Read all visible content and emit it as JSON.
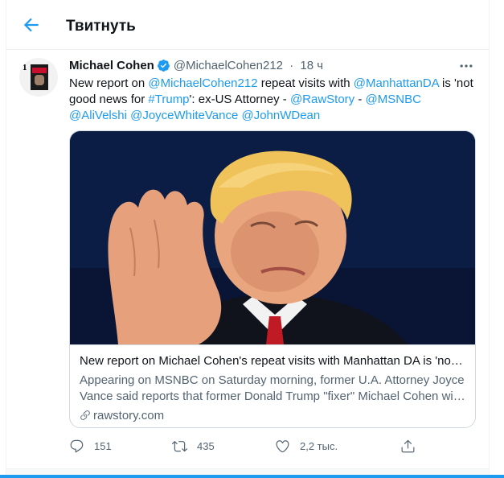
{
  "header": {
    "title": "Твитнуть"
  },
  "tweet": {
    "author_name": "Michael Cohen",
    "handle": "@MichaelCohen212",
    "separator": "·",
    "time": "18 ч",
    "avatar_number": "1",
    "text": {
      "p1": "New report on ",
      "m1": "@MichaelCohen212",
      "p2": " repeat visits with ",
      "m2": "@ManhattanDA",
      "p3": " is 'not good news for ",
      "m3": "#Trump",
      "p4": "': ex-US Attorney - ",
      "m4": "@RawStory",
      "p5": " - ",
      "m5": "@MSNBC",
      "p6": " ",
      "m6": "@AliVelshi",
      "p7": " ",
      "m7": "@JoyceWhiteVance",
      "p8": " ",
      "m8": "@JohnWDean"
    },
    "card": {
      "title": "New report on Michael Cohen's repeat visits with Manhattan DA is 'not good news for Trump': ex-US Attorney",
      "description": "Appearing on MSNBC on Saturday morning, former U.A. Attorney Joyce Vance said reports that former Donald Trump \"fixer\" Michael Cohen will be meeting with the Manhattan District Attorney again",
      "domain": "rawstory.com"
    },
    "actions": {
      "replies": "151",
      "retweets": "435",
      "likes": "2,2 тыс."
    }
  },
  "colors": {
    "accent": "#1d9bf0",
    "text_primary": "#0f1419",
    "text_secondary": "#536471",
    "border": "#cfd9de"
  },
  "icons": {
    "back": "arrow-left-icon",
    "verified": "verified-badge-icon",
    "more": "more-dots-icon",
    "reply": "reply-icon",
    "retweet": "retweet-icon",
    "like": "heart-icon",
    "share": "share-icon",
    "link": "link-icon"
  }
}
